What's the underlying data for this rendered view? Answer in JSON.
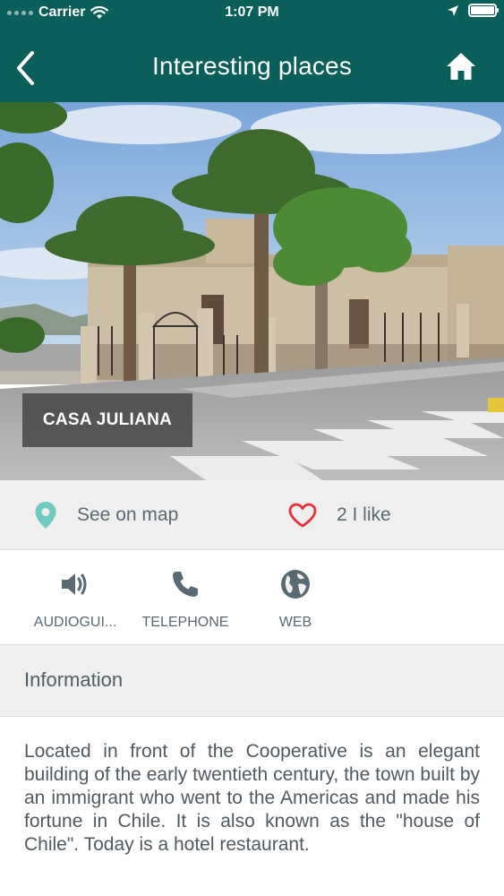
{
  "status_bar": {
    "carrier": "Carrier",
    "time": "1:07 PM",
    "battery_level": 1.0
  },
  "nav": {
    "title": "Interesting places",
    "back_icon": "chevron-left-icon",
    "home_icon": "home-icon"
  },
  "hero": {
    "place_name": "CASA JULIANA"
  },
  "actions": {
    "map_label": "See on map",
    "map_icon": "map-pin-icon",
    "like_label": "2 I like",
    "like_icon": "heart-icon"
  },
  "options": [
    {
      "label": "AUDIOGUI...",
      "icon": "speaker-icon"
    },
    {
      "label": "TELEPHONE",
      "icon": "phone-icon"
    },
    {
      "label": "WEB",
      "icon": "globe-icon"
    }
  ],
  "info": {
    "heading": "Information",
    "body": "Located in front of the Cooperative is an elegant building of the early twentieth century, the town built by an immigrant who went to the Americas and made his fortune in Chile. It is also known as the \"house of Chile\". Today is a hotel restaurant."
  },
  "colors": {
    "header": "#0b5f5a",
    "pin": "#6fcac0",
    "heart": "#e8303a",
    "text": "#5a6a73"
  }
}
